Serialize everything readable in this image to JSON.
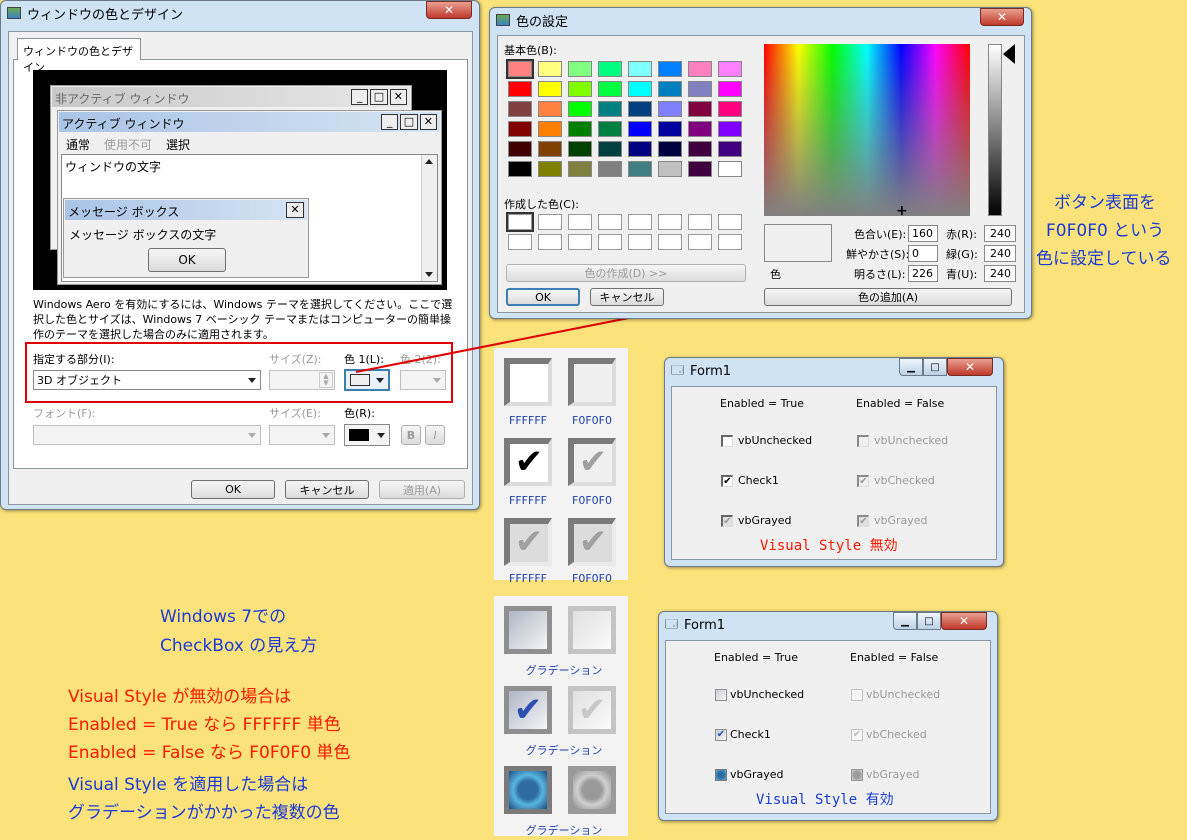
{
  "win1": {
    "title": "ウィンドウの色とデザイン",
    "close": "✕",
    "tab": "ウィンドウの色とデザイン",
    "preview": {
      "inactive_title": "非アクティブ ウィンドウ",
      "active_title": "アクティブ ウィンドウ",
      "menu": [
        "通常",
        "使用不可",
        "選択"
      ],
      "window_text": "ウィンドウの文字",
      "msgbox_title": "メッセージ ボックス",
      "msgbox_text": "メッセージ ボックスの文字",
      "msgbox_ok": "OK"
    },
    "desc": "Windows Aero を有効にするには、Windows テーマを選択してください。ここで選択した色とサイズは、Windows 7 ベーシック テーマまたはコンピューターの簡単操作のテーマを選択した場合のみに適用されます。",
    "item_label": "指定する部分(I):",
    "item_value": "3D オブジェクト",
    "size_label": "サイズ(Z):",
    "color1_label": "色 1(L):",
    "color2_label": "色 2(2):",
    "font_label": "フォント(F):",
    "font_size_label": "サイズ(E):",
    "font_color_label": "色(R):",
    "bold": "B",
    "italic": "I",
    "ok": "OK",
    "cancel": "キャンセル",
    "apply": "適用(A)"
  },
  "win2": {
    "title": "色の設定",
    "close": "✕",
    "basic_label": "基本色(B):",
    "custom_label": "作成した色(C):",
    "define_btn": "色の作成(D) >>",
    "ok": "OK",
    "cancel": "キャンセル",
    "hue_label": "色合い(E):",
    "hue": "160",
    "sat_label": "鮮やかさ(S):",
    "sat": "0",
    "lum_label": "明るさ(L):",
    "lum": "226",
    "red_label": "赤(R):",
    "red": "240",
    "green_label": "緑(G):",
    "green": "240",
    "blue_label": "青(U):",
    "blue": "240",
    "color_label": "色",
    "add_btn": "色の追加(A)",
    "basic_colors": [
      "#ff8080",
      "#ffff80",
      "#80ff80",
      "#00ff80",
      "#80ffff",
      "#0080ff",
      "#ff80c0",
      "#ff80ff",
      "#ff0000",
      "#ffff00",
      "#80ff00",
      "#00ff40",
      "#00ffff",
      "#0080c0",
      "#8080c0",
      "#ff00ff",
      "#804040",
      "#ff8040",
      "#00ff00",
      "#008080",
      "#004080",
      "#8080ff",
      "#800040",
      "#ff0080",
      "#800000",
      "#ff8000",
      "#008000",
      "#008040",
      "#0000ff",
      "#0000a0",
      "#800080",
      "#8000ff",
      "#400000",
      "#804000",
      "#004000",
      "#004040",
      "#000080",
      "#000040",
      "#400040",
      "#400080",
      "#000000",
      "#808000",
      "#808040",
      "#808080",
      "#408080",
      "#c0c0c0",
      "#400040",
      "#ffffff"
    ]
  },
  "annotation": {
    "lines": [
      "ボタン表面を",
      "F0F0F0 という",
      "色に設定している"
    ]
  },
  "boxes": {
    "row1": [
      "FFFFFF",
      "F0F0F0"
    ],
    "row2": [
      "FFFFFF",
      "F0F0F0"
    ],
    "row3": [
      "FFFFFF",
      "F0F0F0"
    ],
    "grad": "グラデーション"
  },
  "form1": {
    "title": "Form1",
    "col1": "Enabled = True",
    "col2": "Enabled = False",
    "r1a": "vbUnchecked",
    "r1b": "vbUnchecked",
    "r2a": "Check1",
    "r2b": "vbChecked",
    "r3a": "vbGrayed",
    "r3b": "vbGrayed",
    "caption": "Visual Style 無効"
  },
  "form2": {
    "title": "Form1",
    "col1": "Enabled = True",
    "col2": "Enabled = False",
    "r1a": "vbUnchecked",
    "r1b": "vbUnchecked",
    "r2a": "Check1",
    "r2b": "vbChecked",
    "r3a": "vbGrayed",
    "r3b": "vbGrayed",
    "caption": "Visual Style 有効"
  },
  "notes": {
    "blue1": "Windows 7での",
    "blue2": "CheckBox の見え方",
    "red1": "Visual Style が無効の場合は",
    "red2": "Enabled = True なら FFFFFF 単色",
    "red3": "Enabled = False なら F0F0F0 単色",
    "blue3": "Visual Style を適用した場合は",
    "blue4": "グラデーションがかかった複数の色"
  }
}
